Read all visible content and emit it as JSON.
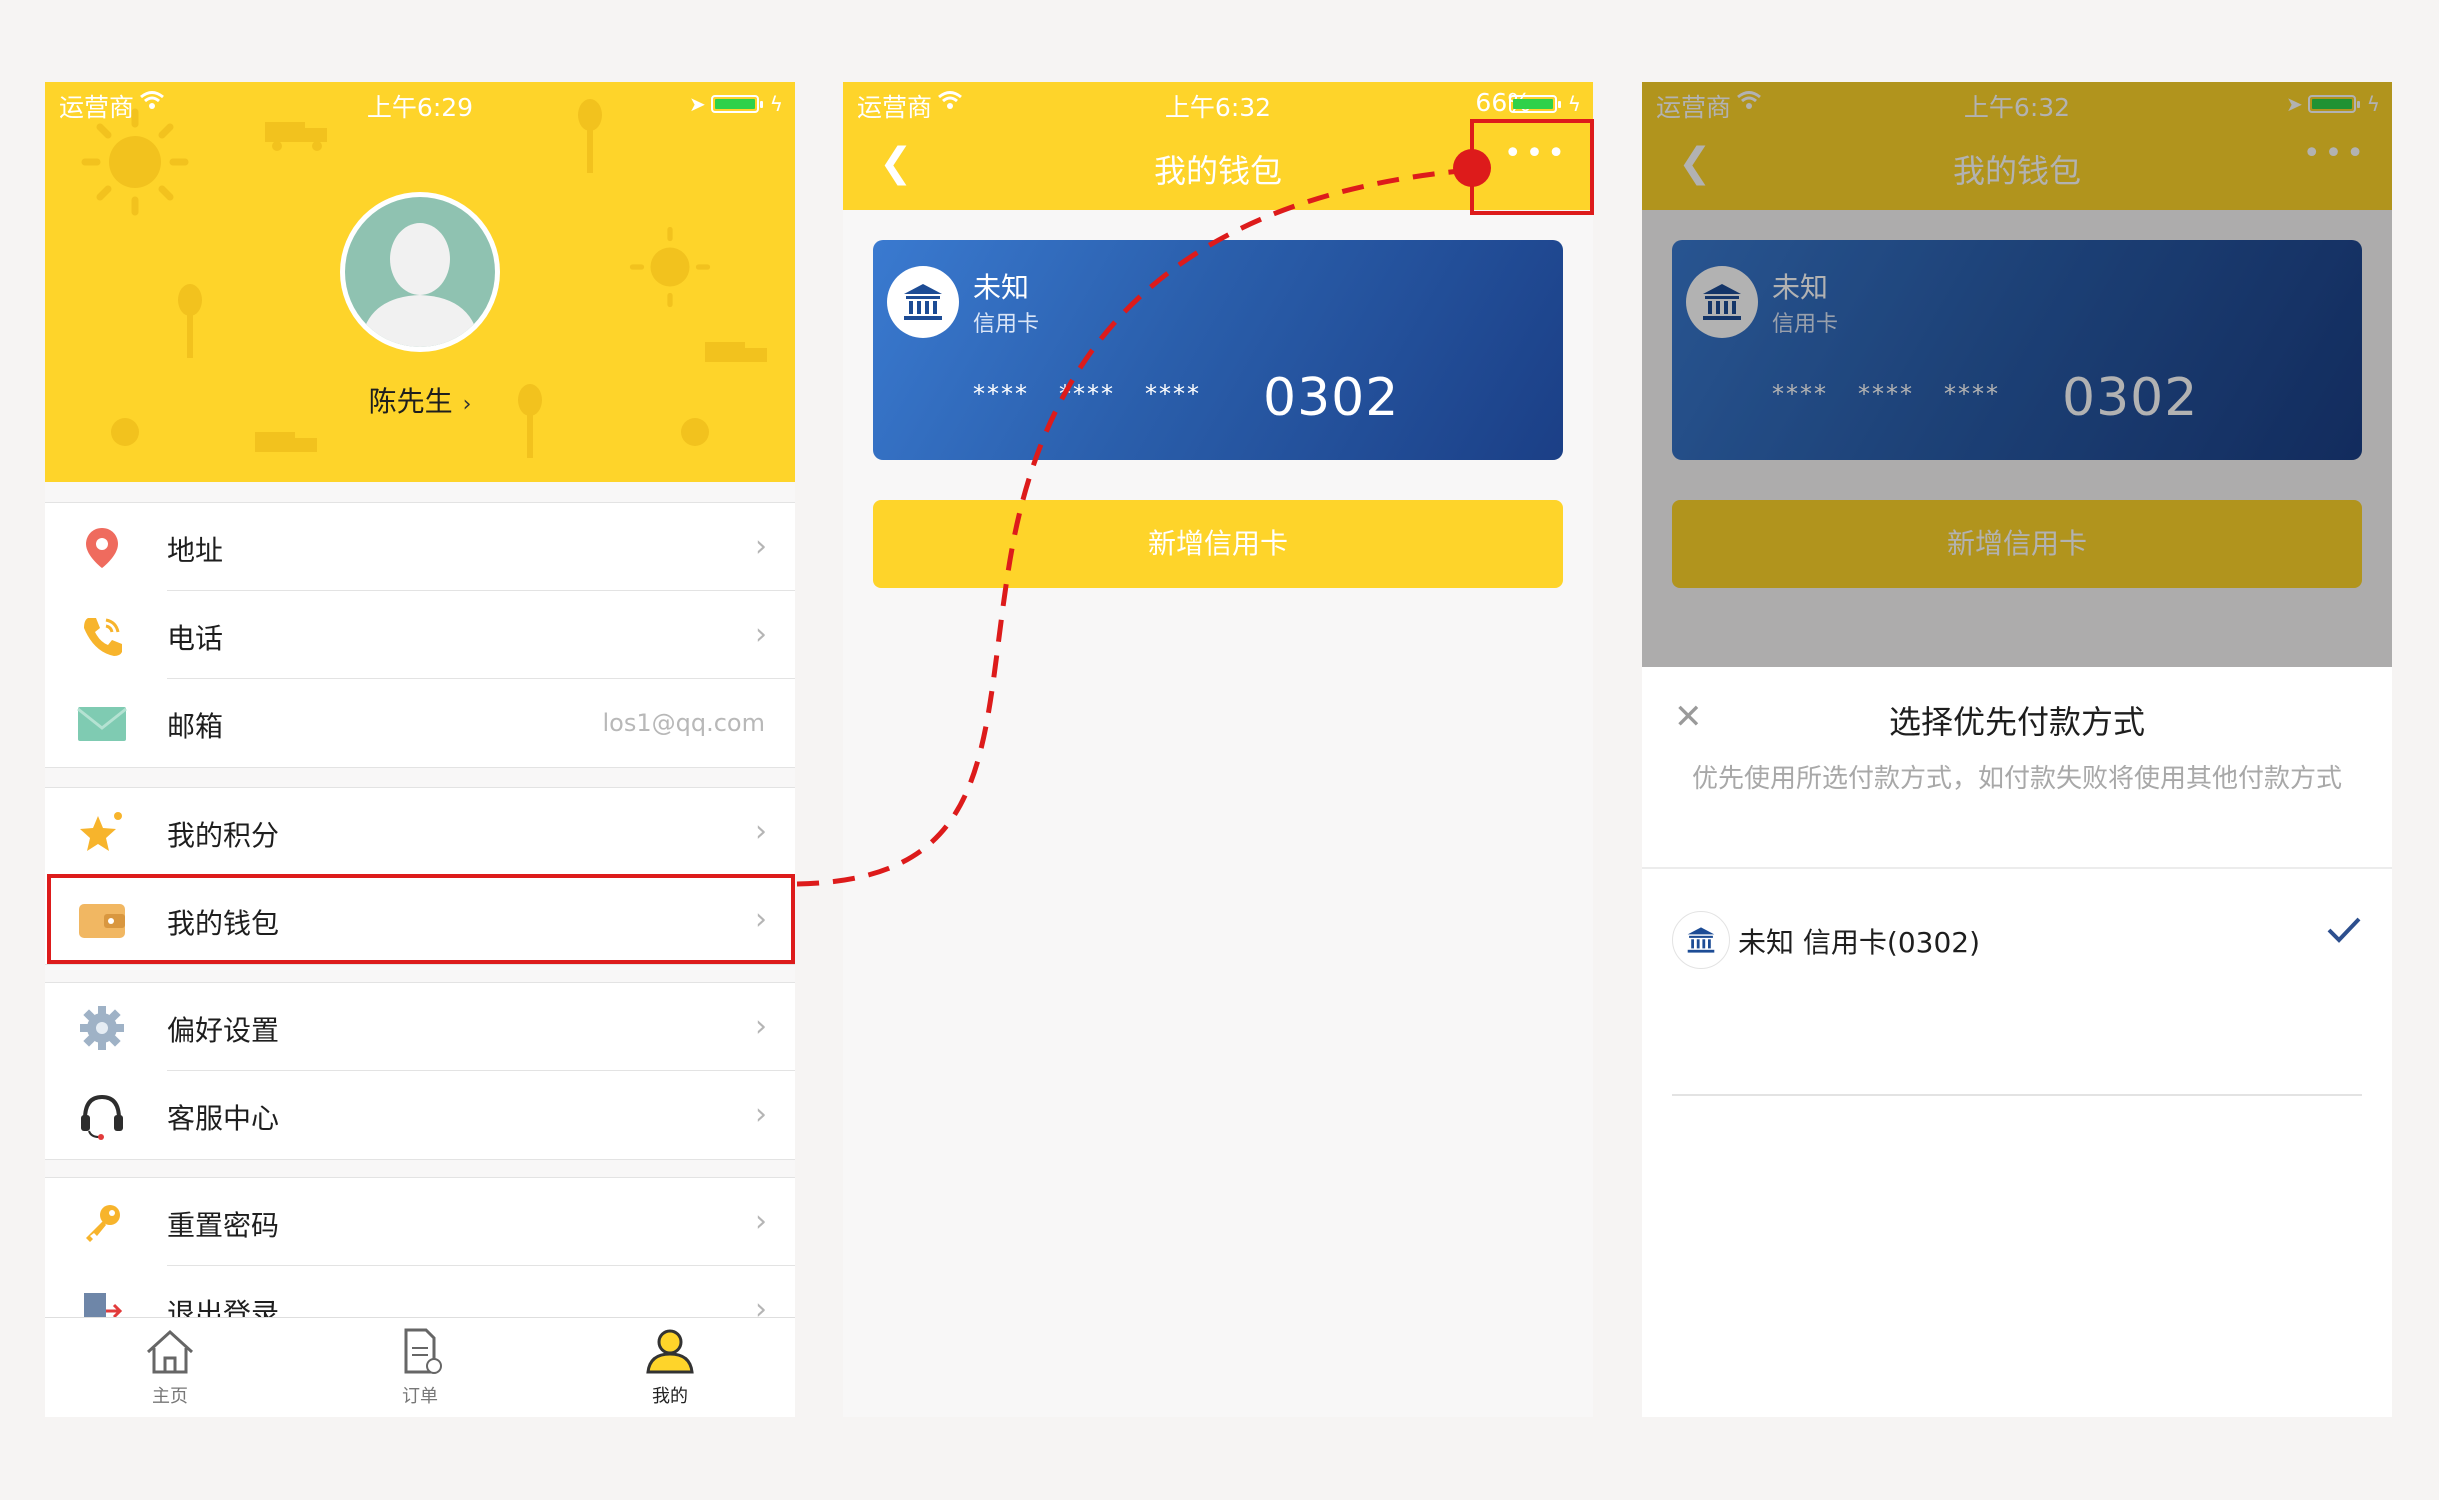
{
  "colors": {
    "brand_yellow": "#fed42a",
    "card_blue": "#2a5eab",
    "highlight_red": "#dd1b1b"
  },
  "screen1": {
    "status": {
      "carrier": "运营商",
      "time": "上午6:29"
    },
    "profile": {
      "name": "陈先生"
    },
    "menu": [
      {
        "icon": "location-pin-icon",
        "label": "地址"
      },
      {
        "icon": "phone-icon",
        "label": "电话"
      },
      {
        "icon": "mail-icon",
        "label": "邮箱",
        "value": "los1@qq.com"
      },
      {
        "icon": "star-icon",
        "label": "我的积分"
      },
      {
        "icon": "wallet-icon",
        "label": "我的钱包"
      },
      {
        "icon": "gear-icon",
        "label": "偏好设置"
      },
      {
        "icon": "headset-icon",
        "label": "客服中心"
      },
      {
        "icon": "key-icon",
        "label": "重置密码"
      },
      {
        "icon": "logout-icon",
        "label": "退出登录"
      }
    ],
    "tabs": [
      {
        "icon": "home-icon",
        "label": "主页"
      },
      {
        "icon": "order-icon",
        "label": "订单"
      },
      {
        "icon": "profile-icon",
        "label": "我的"
      }
    ]
  },
  "screen2": {
    "status": {
      "carrier": "运营商",
      "time": "上午6:32",
      "battery": "66%"
    },
    "nav": {
      "title": "我的钱包",
      "more": "•••"
    },
    "card": {
      "bank": "未知",
      "type": "信用卡",
      "masked": [
        "****",
        "****",
        "****"
      ],
      "last4": "0302"
    },
    "add_button": "新增信用卡"
  },
  "screen3": {
    "status": {
      "carrier": "运营商",
      "time": "上午6:32"
    },
    "nav": {
      "title": "我的钱包",
      "more": "•••"
    },
    "card": {
      "bank": "未知",
      "type": "信用卡",
      "masked": [
        "****",
        "****",
        "****"
      ],
      "last4": "0302"
    },
    "add_button": "新增信用卡",
    "sheet": {
      "title": "选择优先付款方式",
      "description": "优先使用所选付款方式，如付款失败将使用其他付款方式",
      "option": "未知 信用卡(0302)"
    }
  }
}
